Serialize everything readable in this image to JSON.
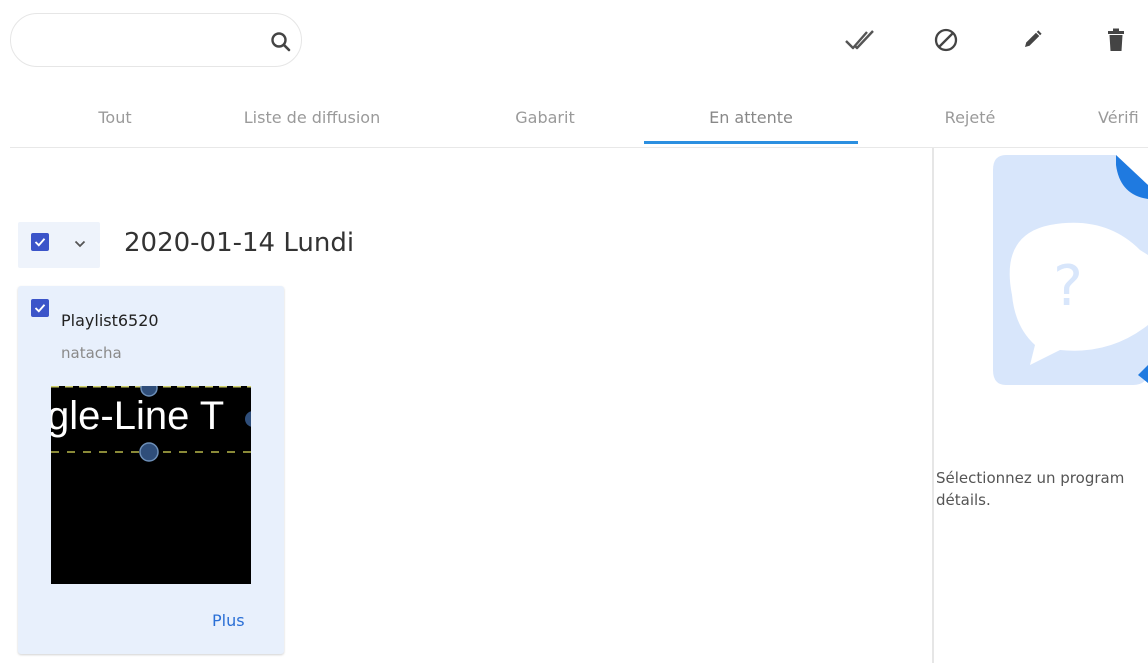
{
  "search": {
    "placeholder": "",
    "value": ""
  },
  "actions": [
    {
      "name": "approve",
      "icon": "double-check-icon"
    },
    {
      "name": "reject",
      "icon": "block-icon"
    },
    {
      "name": "edit",
      "icon": "pencil-icon"
    },
    {
      "name": "delete",
      "icon": "trash-icon"
    }
  ],
  "tabs": [
    {
      "label": "Tout"
    },
    {
      "label": "Liste de diffusion"
    },
    {
      "label": "Gabarit"
    },
    {
      "label": "En attente",
      "active": true
    },
    {
      "label": "Rejeté"
    },
    {
      "label": "Vérifi"
    }
  ],
  "group": {
    "date": "2020-01-14 Lundi",
    "checked": true
  },
  "card": {
    "title": "Playlist6520",
    "user": "natacha",
    "thumbnail_text": "gle-Line T",
    "more_label": "Plus",
    "checked": true
  },
  "detail_panel": {
    "empty_text_line1": "Sélectionnez un program",
    "empty_text_line2": "détails."
  },
  "colors": {
    "accent": "#2b8fe0",
    "checkbox": "#3b54c9",
    "card_bg": "#e8f0fc",
    "link": "#2a6fd6",
    "illustration": "#d8e6fb",
    "illustration_corner": "#1f7ae0"
  }
}
